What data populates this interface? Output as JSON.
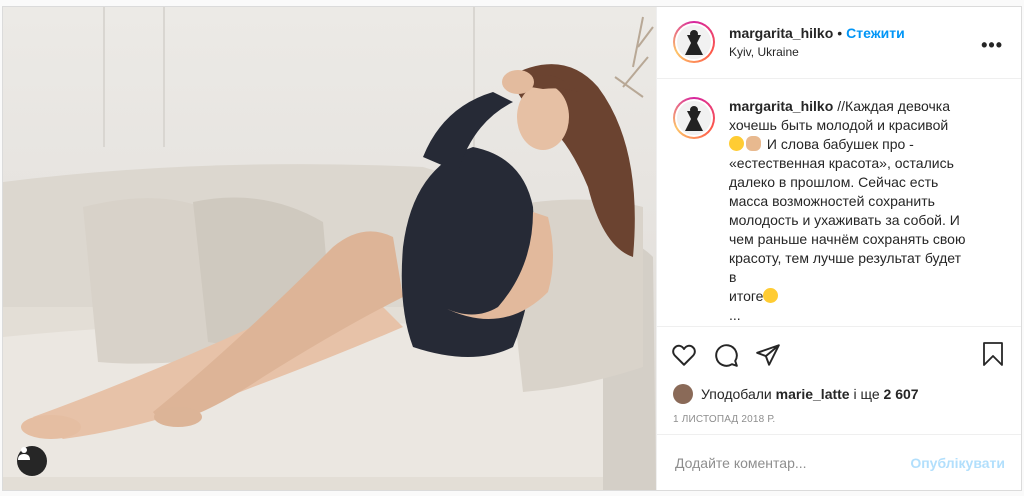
{
  "post": {
    "username": "margarita_hilko",
    "follow_label": "Стежити",
    "separator": "•",
    "location": "Kyiv, Ukraine",
    "more_label": "•••",
    "caption": {
      "lines": [
        "//Каждая девочка",
        "хочешь быть молодой и красивой",
        "И слова бабушек про -",
        "«естественная красота», остались",
        "далеко в прошлом. Сейчас есть",
        "масса возможностей сохранить",
        "молодость и ухаживать за собой. И",
        "чем раньше начнём сохранять свою",
        "красоту, тем лучше результат будет в",
        "итоге"
      ],
      "ellipsis": "..."
    },
    "likes": {
      "prefix": "Уподобали",
      "user": "marie_latte",
      "middle": "і ще",
      "count": "2 607"
    },
    "date": "1 ЛИСТОПАД 2018 Р.",
    "comment_placeholder": "Додайте коментар...",
    "publish_label": "Опублікувати"
  },
  "colors": {
    "accent": "#0095f6",
    "publish_disabled": "#b2dffc",
    "text": "#262626",
    "muted": "#8e8e8e",
    "border": "#dbdbdb"
  },
  "icons": [
    "heart-icon",
    "comment-icon",
    "share-icon",
    "bookmark-icon",
    "user-tag-icon",
    "more-icon"
  ]
}
